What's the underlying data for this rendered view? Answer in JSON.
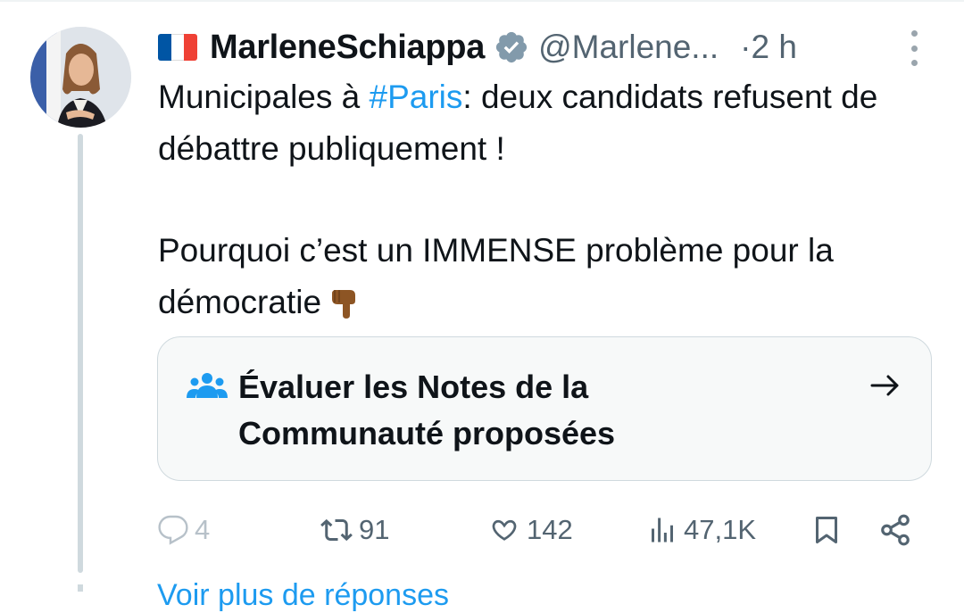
{
  "author": {
    "display_name": "MarleneSchiappa",
    "handle": "@Marlene...",
    "timestamp_prefix": "·",
    "timestamp": "2 h",
    "flag_colors": [
      "#0055a4",
      "#ffffff",
      "#ef4135"
    ],
    "verified_color": "#829aab"
  },
  "tweet": {
    "line1_before": "Municipales à ",
    "hashtag": "#Paris",
    "line1_after": ": deux candidats refusent de débattre publiquement !",
    "paragraph2": "Pourquoi c’est un IMMENSE problème pour la démocratie",
    "emoji": "backhand-index-pointing-down"
  },
  "community_notes": {
    "label": "Évaluer les Notes de la Communauté proposées",
    "icon": "people-icon",
    "arrow": "arrow-right-icon",
    "accent": "#1d9bf0"
  },
  "actions": {
    "replies": "4",
    "retweets": "91",
    "likes": "142",
    "views": "47,1K"
  },
  "below": {
    "text": "Voir plus de réponses"
  }
}
